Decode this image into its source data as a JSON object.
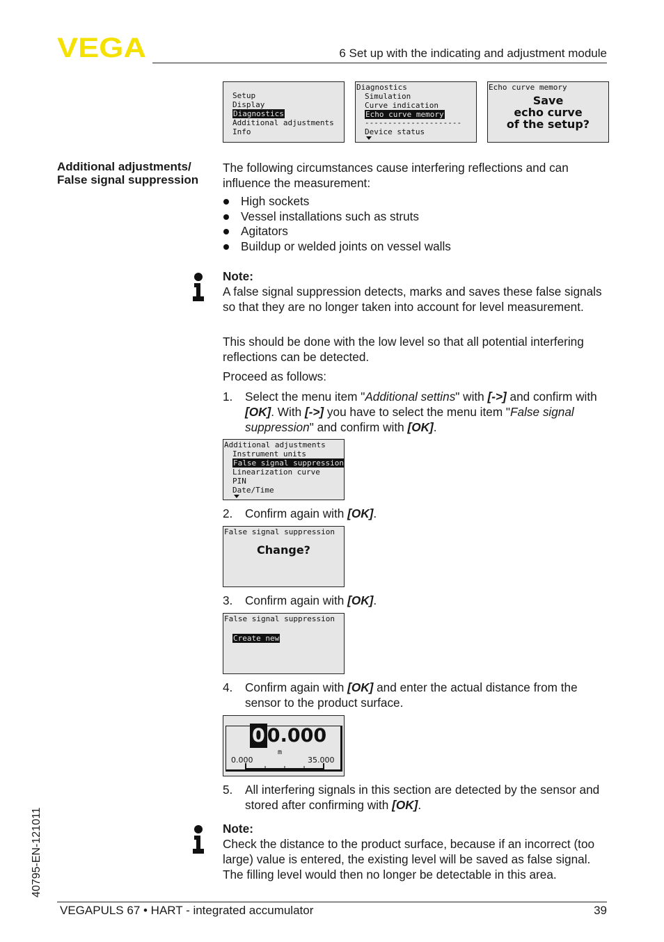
{
  "header": {
    "logo": "VEGA",
    "section_title": "6 Set up with the indicating and adjustment module",
    "brand_color": "#f5e100"
  },
  "screens_top": [
    {
      "lines": [
        "",
        "Setup",
        "Display",
        "Diagnostics",
        "Additional adjustments",
        "Info"
      ],
      "highlight": "Diagnostics"
    },
    {
      "lines": [
        "Diagnostics",
        "Simulation",
        "Curve indication",
        "Echo curve memory",
        "---------------------",
        "Device status"
      ],
      "highlight": "Echo curve memory",
      "scroll_down": true
    },
    {
      "title": "Echo curve memory",
      "message": [
        "Save",
        "echo curve",
        "of the setup?"
      ]
    }
  ],
  "side_heading": "Additional adjustments/ False signal suppression",
  "intro": "The following circumstances cause interfering reflections and can influence the measurement:",
  "bullets": [
    "High sockets",
    "Vessel installations such as struts",
    "Agitators",
    "Buildup or welded joints on vessel walls"
  ],
  "note1": {
    "label": "Note:",
    "text": "A false signal suppression detects, marks and saves these false signals so that they are no longer taken into account for level measurement."
  },
  "paragraph1": "This should be done with the low level so that all potential interfering reflections can be detected.",
  "paragraph2": "Proceed as follows:",
  "steps": [
    {
      "num": "1."
    },
    {
      "num": "2.",
      "text": "Confirm again with ",
      "key": "[OK]",
      "after": "."
    },
    {
      "num": "3.",
      "text": "Confirm again with ",
      "key": "[OK]",
      "after": "."
    },
    {
      "num": "4.",
      "text": "Confirm again with ",
      "key": "[OK]",
      "after": " and enter the actual distance from the sensor to the product surface."
    },
    {
      "num": "5.",
      "text": "All interfering signals in this section are detected by the sensor and stored after confirming with ",
      "key": "[OK]",
      "after": "."
    }
  ],
  "step1": {
    "a": "Select the menu item \"",
    "b": "Additional settins",
    "c": "\" with ",
    "d": "[->]",
    "e": " and confirm with ",
    "f": "[OK]",
    "g": ". With ",
    "h": "[->]",
    "i": " you have to select the menu item \"",
    "j": "False signal suppression",
    "k": "\" and confirm with ",
    "l": "[OK]",
    "m": "."
  },
  "screen_additional": {
    "lines": [
      "Additional adjustments",
      "Instrument units",
      "False signal suppression",
      "Linearization curve",
      "PIN",
      "Date/Time"
    ],
    "highlight": "False signal suppression",
    "scroll_down": true
  },
  "screen_change": {
    "title": "False signal suppression",
    "message": "Change?"
  },
  "screen_create": {
    "title": "False signal suppression",
    "item": "Create new"
  },
  "screen_distance": {
    "cursor_digit": "0",
    "value_rest": "0.000",
    "unit": "m",
    "min": "0.000",
    "max": "35.000"
  },
  "note2": {
    "label": "Note:",
    "text": "Check the distance to the product surface, because if an incorrect (too large) value is entered, the existing level will be saved as false signal. The filling level would then no longer be detectable in this area."
  },
  "footer": {
    "product": "VEGAPULS 67 • HART - integrated accumulator",
    "page": "39",
    "doc_id": "40795-EN-121011"
  }
}
